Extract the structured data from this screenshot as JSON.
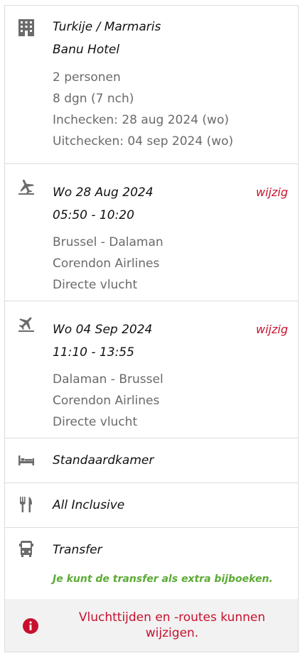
{
  "hotel": {
    "location": "Turkije / Marmaris",
    "name": "Banu Hotel",
    "persons": "2 personen",
    "duration": "8 dgn (7 nch)",
    "checkin": "Inchecken: 28 aug 2024 (wo)",
    "checkout": "Uitchecken: 04 sep 2024 (wo)",
    "icon": "building-icon"
  },
  "outbound": {
    "date": "Wo 28 Aug 2024",
    "time": "05:50 - 10:20",
    "route": "Brussel - Dalaman",
    "airline": "Corendon Airlines",
    "type": "Directe vlucht",
    "change_label": "wijzig",
    "icon": "plane-departure-icon"
  },
  "return": {
    "date": "Wo 04 Sep 2024",
    "time": "11:10 - 13:55",
    "route": "Dalaman - Brussel",
    "airline": "Corendon Airlines",
    "type": "Directe vlucht",
    "change_label": "wijzig",
    "icon": "plane-arrival-icon"
  },
  "room": {
    "label": "Standaardkamer",
    "icon": "bed-icon"
  },
  "board": {
    "label": "All Inclusive",
    "icon": "fork-knife-icon"
  },
  "transfer": {
    "label": "Transfer",
    "note": "Je kunt de transfer als extra bijboeken.",
    "icon": "bus-icon"
  },
  "notice": {
    "text": "Vluchttijden en -routes kunnen wijzigen.",
    "icon": "info-icon"
  },
  "colors": {
    "accent_red": "#c8102e",
    "green": "#5cab35",
    "text_gray": "#6a6a6a"
  }
}
